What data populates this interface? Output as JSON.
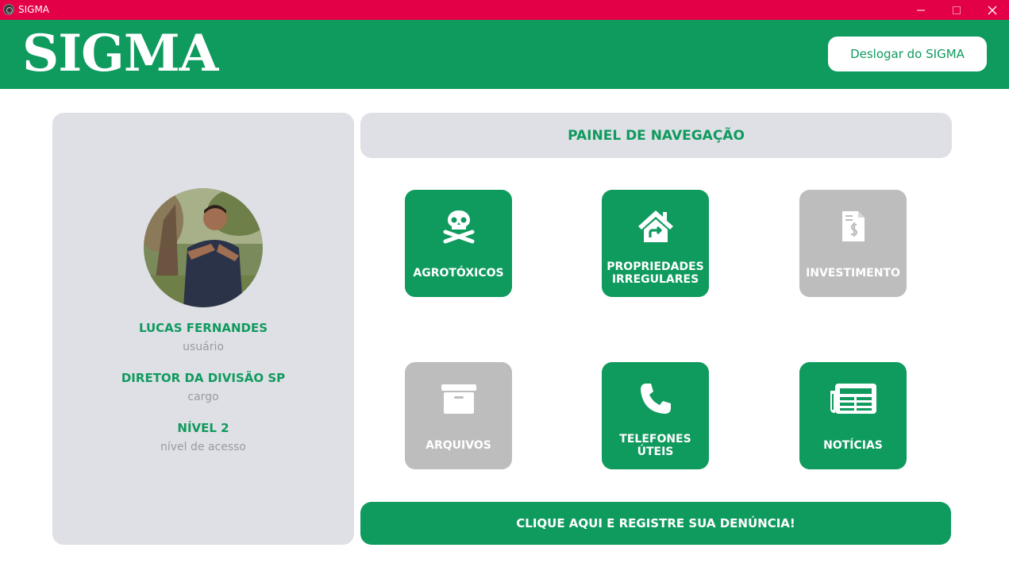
{
  "window": {
    "title": "SIGMA",
    "titlebar_color": "#e30046",
    "controls": [
      "minimize-icon",
      "maximize-icon",
      "close-icon"
    ]
  },
  "header": {
    "logo": "SIGMA",
    "logout_label": "Deslogar do SIGMA",
    "brand_color": "#0f9a5e"
  },
  "profile": {
    "name": "LUCAS FERNANDES",
    "name_caption": "usuário",
    "role": "DIRETOR DA DIVISÃO SP",
    "role_caption": "cargo",
    "level": "NÍVEL 2",
    "level_caption": "nível de acesso"
  },
  "nav": {
    "title": "PAINEL DE NAVEGAÇÃO",
    "tiles": [
      {
        "label_1": "AGROTÓXICOS",
        "label_2": "",
        "icon": "skull-crossbones-icon",
        "enabled": true
      },
      {
        "label_1": "PROPRIEDADES",
        "label_2": "IRREGULARES",
        "icon": "house-return-icon",
        "enabled": true
      },
      {
        "label_1": "INVESTIMENTO",
        "label_2": "",
        "icon": "invoice-dollar-icon",
        "enabled": false
      },
      {
        "label_1": "ARQUIVOS",
        "label_2": "",
        "icon": "archive-box-icon",
        "enabled": false
      },
      {
        "label_1": "TELEFONES",
        "label_2": "ÚTEIS",
        "icon": "phone-icon",
        "enabled": true
      },
      {
        "label_1": "NOTÍCIAS",
        "label_2": "",
        "icon": "newspaper-icon",
        "enabled": true
      }
    ]
  },
  "report": {
    "label": "CLIQUE AQUI E REGISTRE SUA DENÚNCIA!"
  },
  "colors": {
    "green": "#0f9a5e",
    "panel_gray": "#dfe0e6",
    "disabled_gray": "#bdbdbd",
    "caption_gray": "#9a9aa0"
  }
}
